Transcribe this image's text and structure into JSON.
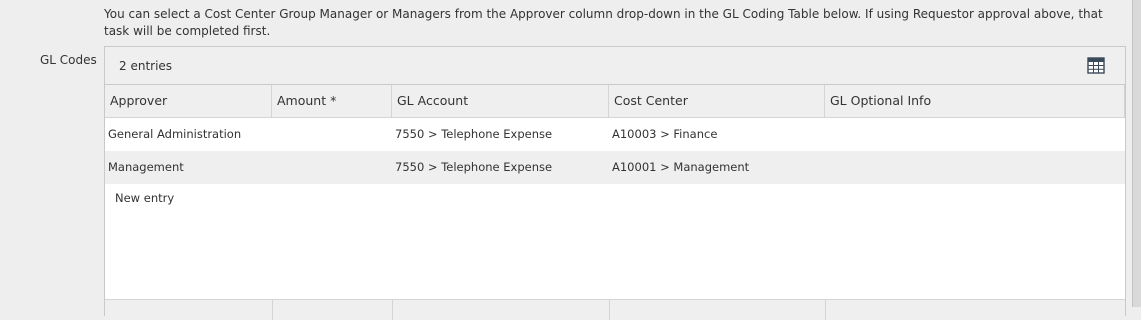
{
  "intro_text": "You can select a Cost Center Group Manager or Managers from the Approver column drop-down in the GL Coding Table below. If using Requestor approval above, that task will be completed first.",
  "field_label": "GL Codes",
  "grid": {
    "entry_count": "2 entries",
    "toolbar_icon": "table-icon",
    "columns": [
      "Approver",
      "Amount *",
      "GL Account",
      "Cost Center",
      "GL Optional Info"
    ],
    "rows": [
      {
        "approver": "General Administration",
        "amount": "",
        "gl_account": "7550 > Telephone Expense",
        "cost_center": "A10003 > Finance",
        "gl_optional_info": ""
      },
      {
        "approver": "Management",
        "amount": "",
        "gl_account": "7550 > Telephone Expense",
        "cost_center": "A10001 > Management",
        "gl_optional_info": ""
      }
    ],
    "new_entry_label": "New entry"
  }
}
